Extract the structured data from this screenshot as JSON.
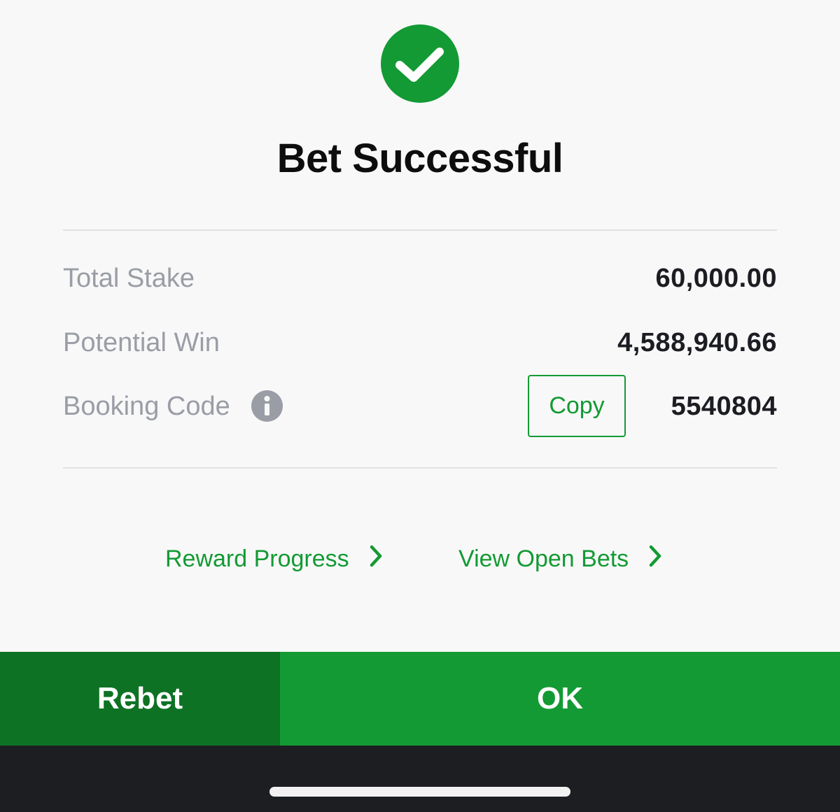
{
  "header": {
    "icon": "check-circle-icon",
    "title": "Bet Successful"
  },
  "summary": {
    "total_stake_label": "Total Stake",
    "total_stake_value": "60,000.00",
    "potential_win_label": "Potential Win",
    "potential_win_value": "4,588,940.66",
    "booking_code_label": "Booking Code",
    "booking_code_info_icon": "info-icon",
    "copy_label": "Copy",
    "booking_code_value": "5540804"
  },
  "links": {
    "reward_progress": "Reward Progress",
    "view_open_bets": "View Open Bets"
  },
  "actions": {
    "rebet_label": "Rebet",
    "ok_label": "OK"
  },
  "colors": {
    "accent": "#139a34",
    "accent_dark": "#0e7224",
    "label_gray": "#9a9da5",
    "home_bar": "#1c1e22"
  }
}
